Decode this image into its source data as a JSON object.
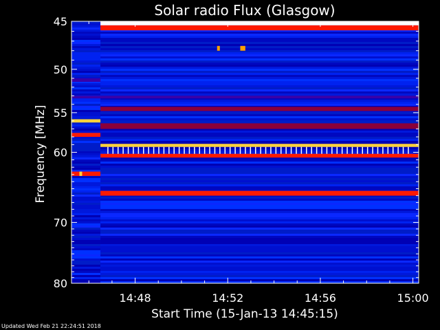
{
  "chart_data": {
    "type": "heatmap",
    "title": "Solar radio Flux (Glasgow)",
    "xlabel": "Start Time (15-Jan-13 14:45:15)",
    "ylabel": "Frequency [MHz]",
    "x_start_min": 0.25,
    "xlim_minutes": [
      0.25,
      15.25
    ],
    "x_ticks": [
      {
        "value": 3,
        "label": "14:48"
      },
      {
        "value": 7,
        "label": "14:52"
      },
      {
        "value": 11,
        "label": "14:56"
      },
      {
        "value": 15,
        "label": "15:00"
      }
    ],
    "ylim": [
      45,
      80
    ],
    "y_scale": "log",
    "y_ticks": [
      45,
      50,
      55,
      60,
      70,
      80
    ],
    "colormap": [
      "#0000a0",
      "#0033ff",
      "#3a00a8",
      "#8b003a",
      "#ff0000",
      "#ffb000",
      "#ffffff"
    ],
    "data_gap_end_minute": 1.5,
    "bands": [
      {
        "freq": [
          45.0,
          45.4
        ],
        "intensity": "white",
        "from_minute": 1.5,
        "to_minute": 15.25
      },
      {
        "freq": [
          45.4,
          45.9
        ],
        "intensity": "red",
        "from_minute": 1.5,
        "to_minute": 15.25
      },
      {
        "freq": [
          51.0,
          51.4
        ],
        "intensity": "purple",
        "from_minute": 0.25,
        "to_minute": 1.5
      },
      {
        "freq": [
          53.0,
          53.3
        ],
        "intensity": "purple",
        "from_minute": 0.25,
        "to_minute": 15.25
      },
      {
        "freq": [
          54.3,
          54.8
        ],
        "intensity": "darkred",
        "from_minute": 1.5,
        "to_minute": 15.25
      },
      {
        "freq": [
          55.8,
          56.2
        ],
        "intensity": "yellow",
        "from_minute": 0.25,
        "to_minute": 1.5
      },
      {
        "freq": [
          56.3,
          57.0
        ],
        "intensity": "darkred",
        "from_minute": 1.5,
        "to_minute": 15.25
      },
      {
        "freq": [
          57.5,
          58.0
        ],
        "intensity": "red",
        "from_minute": 0.25,
        "to_minute": 1.5
      },
      {
        "freq": [
          58.9,
          59.3
        ],
        "intensity": "yellow",
        "from_minute": 1.5,
        "to_minute": 15.25
      },
      {
        "freq": [
          60.2,
          60.7
        ],
        "intensity": "red",
        "from_minute": 1.5,
        "to_minute": 15.25
      },
      {
        "freq": [
          62.6,
          63.2
        ],
        "intensity": "red",
        "from_minute": 0.25,
        "to_minute": 1.5
      },
      {
        "freq": [
          65.3,
          66.0
        ],
        "intensity": "red",
        "from_minute": 1.5,
        "to_minute": 15.25
      }
    ],
    "bursts": [
      {
        "minute": 6.6,
        "freq": [
          47.5,
          48.0
        ],
        "intensity": "orange"
      },
      {
        "minute": 7.6,
        "freq": [
          47.5,
          48.0
        ],
        "intensity": "orange"
      },
      {
        "minute": 7.7,
        "freq": [
          47.5,
          48.0
        ],
        "intensity": "orange"
      },
      {
        "minute": 0.65,
        "freq": [
          62.6,
          63.2
        ],
        "intensity": "yellow"
      }
    ],
    "footer": "Updated Wed Feb 21 22:24:51 2018"
  }
}
